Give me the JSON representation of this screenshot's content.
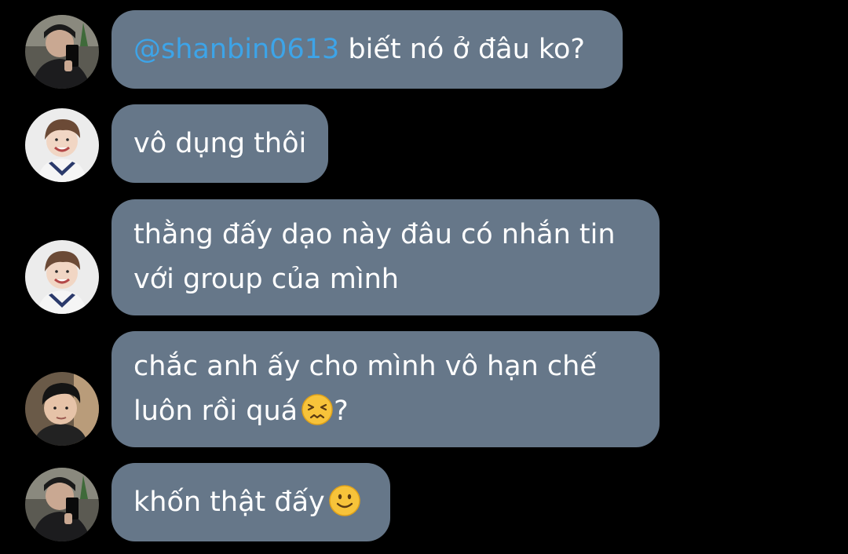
{
  "messages": [
    {
      "sender_avatar": "avatar-mirror-selfie",
      "mention": "@shanbin0613",
      "lines": [
        " biết nó ở đâu ko?"
      ]
    },
    {
      "sender_avatar": "avatar-smiling-boy",
      "lines": [
        "vô dụng thôi"
      ]
    },
    {
      "sender_avatar": "avatar-smiling-boy",
      "lines": [
        "thằng đấy dạo này đâu có nhắn tin",
        "với group của mình"
      ]
    },
    {
      "sender_avatar": "avatar-dark-hair-boy",
      "lines": [
        "chắc anh ấy cho mình vô hạn chế",
        "luôn rồi quá",
        "?"
      ],
      "emoji": "persevering-face-emoji"
    },
    {
      "sender_avatar": "avatar-mirror-selfie",
      "lines": [
        "khốn thật đấy"
      ],
      "emoji": "slightly-smiling-face-emoji"
    }
  ],
  "colors": {
    "background": "#000000",
    "bubble": "#667789",
    "text": "#ffffff",
    "mention": "#3da4e8"
  }
}
